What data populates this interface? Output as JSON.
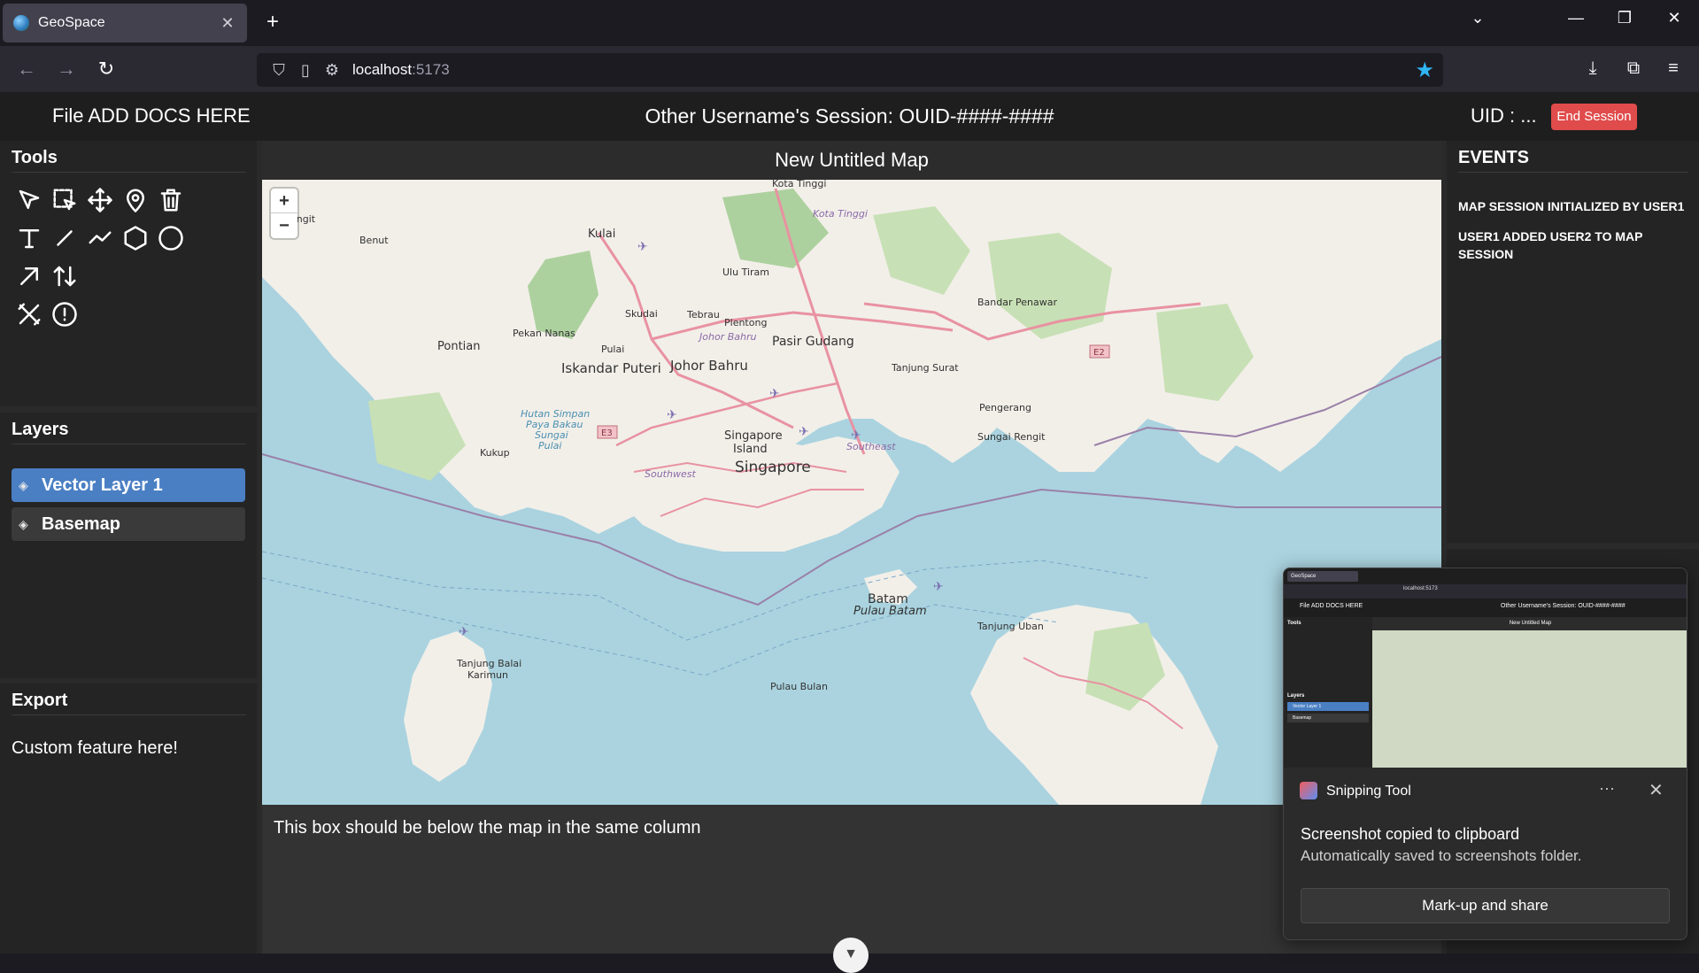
{
  "browser": {
    "tab_title": "GeoSpace",
    "url_host": "localhost",
    "url_port": ":5173"
  },
  "header": {
    "file_label": "File ADD DOCS HERE",
    "session_title": "Other Username's Session: OUID-####-####",
    "uid_label": "UID : ...",
    "end_session": "End Session"
  },
  "tools": {
    "title": "Tools",
    "items": [
      "pointer-tool",
      "box-select-tool",
      "move-tool",
      "place-marker-tool",
      "delete-tool",
      "text-tool",
      "line-tool",
      "freehand-tool",
      "polygon-tool",
      "circle-tool",
      "arrow-tool",
      "swap-tool",
      "clear-tool",
      "info-tool"
    ]
  },
  "layers": {
    "title": "Layers",
    "items": [
      {
        "label": "Vector Layer 1",
        "active": true
      },
      {
        "label": "Basemap",
        "active": false
      }
    ]
  },
  "export": {
    "title": "Export",
    "custom": "Custom feature here!"
  },
  "map": {
    "title": "New Untitled Map",
    "zoom_in": "+",
    "zoom_out": "−",
    "labels": {
      "kota_tinggi": "Kota Tinggi",
      "kota_tinggi2": "Kota Tinggi",
      "kulai": "Kulai",
      "benut": "Benut",
      "engit": "engit",
      "ulu_tiram": "Ulu Tiram",
      "bandar_penawar": "Bandar Penawar",
      "skudai": "Skudai",
      "tebrau": "Tebrau",
      "plentong": "Plentong",
      "johor_bahru_small": "Johor Bahru",
      "pasir_gudang": "Pasir Gudang",
      "pekan_nanas": "Pekan Nanas",
      "pontian": "Pontian",
      "pulai": "Pulai",
      "iskandar_puteri": "Iskandar Puteri",
      "johor_bahru": "Johor Bahru",
      "tanjung_surat": "Tanjung Surat",
      "pengerang": "Pengerang",
      "sungai_rengit": "Sungai Rengit",
      "hutan_simpan": "Hutan Simpan",
      "paya_bakau": "Paya Bakau",
      "sungai": "Sungai",
      "pulai2": "Pulai",
      "kukup": "Kukup",
      "singapore_island": "Singapore",
      "island": "Island",
      "singapore": "Singapore",
      "southeast": "Southeast",
      "southwest": "Southwest",
      "batam": "Batam",
      "pulau_batam": "Pulau Batam",
      "tanjung_uban": "Tanjung Uban",
      "tanjung_balai": "Tanjung Balai",
      "karimun": "Karimun",
      "pulau_bulan": "Pulau Bulan",
      "e2": "E2",
      "e3": "E3"
    }
  },
  "below_map": "This box should be below the map in the same column",
  "events": {
    "title": "EVENTS",
    "items": [
      "MAP SESSION INITIALIZED BY USER1",
      "USER1 ADDED USER2 TO MAP SESSION"
    ]
  },
  "toast": {
    "app": "Snipping Tool",
    "more": "···",
    "close": "✕",
    "msg1": "Screenshot copied to clipboard",
    "msg2": "Automatically saved to screenshots folder.",
    "action": "Mark-up and share",
    "thumb": {
      "tab": "GeoSpace",
      "url": "localhost:5173",
      "file": "File ADD DOCS HERE",
      "session": "Other Username's Session: OUID-####-####",
      "map_title": "New Untitled Map",
      "tools": "Tools",
      "layers": "Layers",
      "layer1": "Vector Layer 1",
      "layer2": "Basemap"
    }
  },
  "colors": {
    "accent": "#4a7fc4",
    "danger": "#e04b4b",
    "water": "#aad3df",
    "land": "#f2efe9",
    "forest": "#add19e",
    "road": "#e892a2",
    "star": "#2fb6f5"
  }
}
